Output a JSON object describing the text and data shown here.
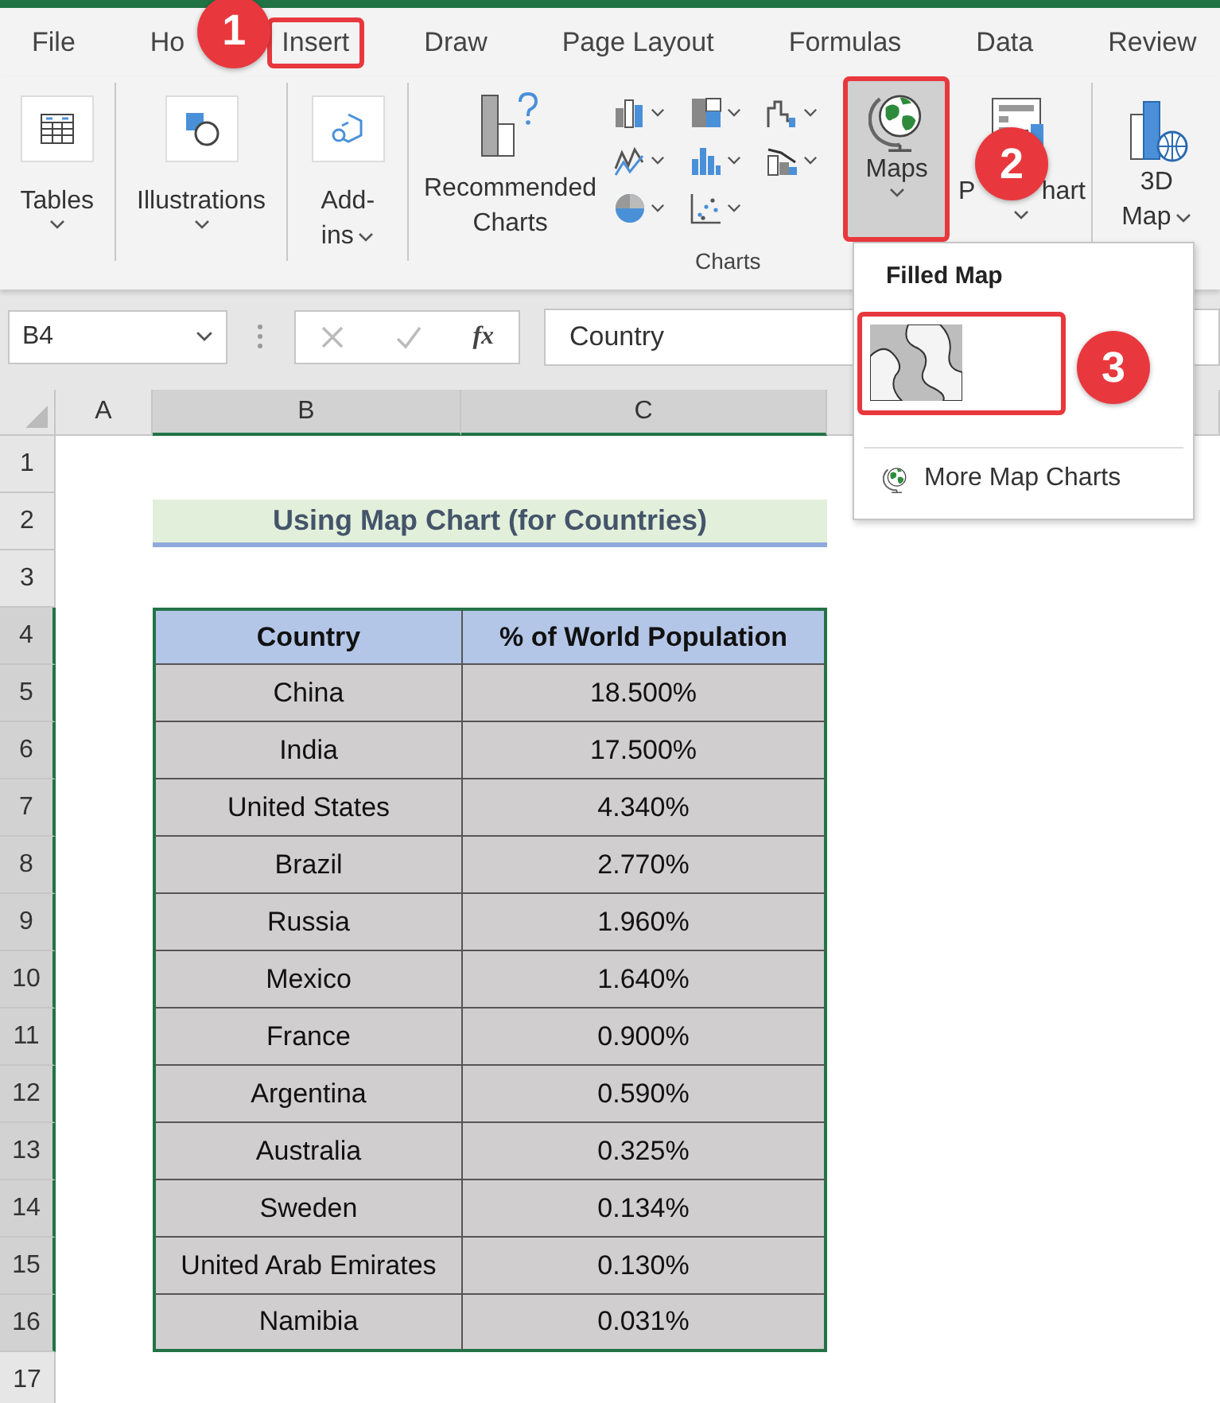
{
  "ribbon_tabs": [
    {
      "label": "File",
      "selected": false
    },
    {
      "label": "Ho",
      "selected": false
    },
    {
      "label": "Insert",
      "selected": true
    },
    {
      "label": "Draw",
      "selected": false
    },
    {
      "label": "Page Layout",
      "selected": false
    },
    {
      "label": "Formulas",
      "selected": false
    },
    {
      "label": "Data",
      "selected": false
    },
    {
      "label": "Review",
      "selected": false
    }
  ],
  "ribbon": {
    "tables": "Tables",
    "illustrations": "Illustrations",
    "addins": [
      "Add-",
      "ins"
    ],
    "recommended_charts": [
      "Recommended",
      "Charts"
    ],
    "maps": "Maps",
    "pivotchart": [
      "P",
      "hart"
    ],
    "map_3d": [
      "3D",
      "Map"
    ],
    "group_label": "Charts"
  },
  "callouts": [
    "1",
    "2",
    "3"
  ],
  "formula_bar": {
    "name_box": "B4",
    "function_label": "fx",
    "value": "Country"
  },
  "columns": [
    "A",
    "B",
    "C"
  ],
  "row_numbers": [
    "1",
    "2",
    "3",
    "4",
    "5",
    "6",
    "7",
    "8",
    "9",
    "10",
    "11",
    "12",
    "13",
    "14",
    "15",
    "16",
    "17"
  ],
  "title": "Using Map Chart (for Countries)",
  "table": {
    "columns": [
      "Country",
      "% of World Population"
    ],
    "rows": [
      [
        "China",
        "18.500%"
      ],
      [
        "India",
        "17.500%"
      ],
      [
        "United States",
        "4.340%"
      ],
      [
        "Brazil",
        "2.770%"
      ],
      [
        "Russia",
        "1.960%"
      ],
      [
        "Mexico",
        "1.640%"
      ],
      [
        "France",
        "0.900%"
      ],
      [
        "Argentina",
        "0.590%"
      ],
      [
        "Australia",
        "0.325%"
      ],
      [
        "Sweden",
        "0.134%"
      ],
      [
        "United Arab Emirates",
        "0.130%"
      ],
      [
        "Namibia",
        "0.031%"
      ]
    ]
  },
  "maps_menu": {
    "heading": "Filled Map",
    "more": "More Map Charts"
  }
}
